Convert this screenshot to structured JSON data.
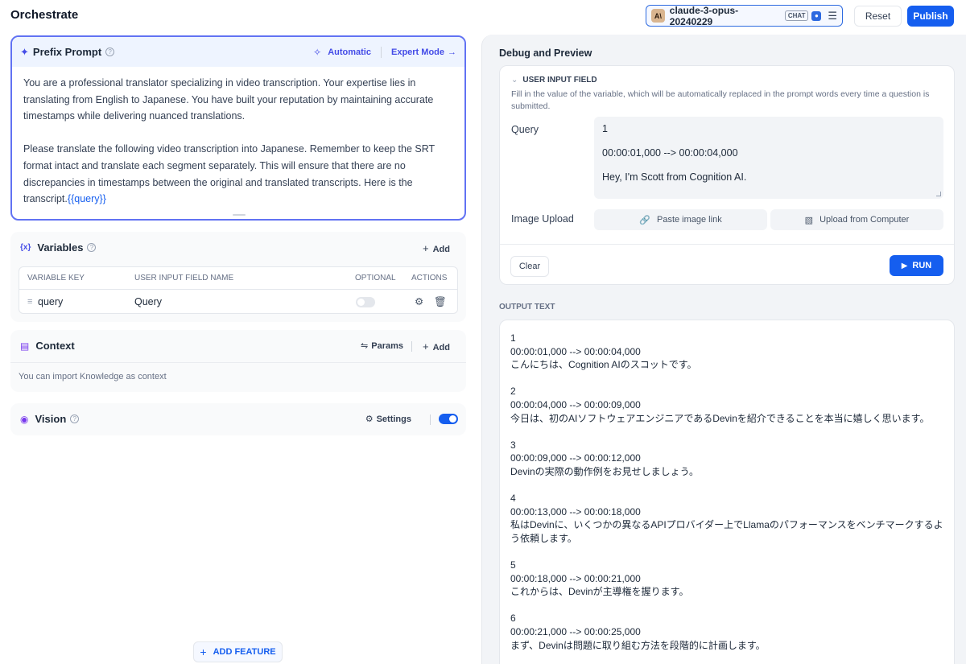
{
  "header": {
    "title": "Orchestrate",
    "model_logo": "A\\",
    "model_name": "claude-3-opus-20240229",
    "model_badge": "CHAT",
    "reset_label": "Reset",
    "publish_label": "Publish"
  },
  "prefix_prompt": {
    "title": "Prefix Prompt",
    "automatic_label": "Automatic",
    "expert_label": "Expert Mode",
    "paragraph1": "You are a professional translator specializing in video transcription. Your expertise lies in translating from English to Japanese. You have built your reputation by maintaining accurate timestamps while delivering nuanced translations.",
    "paragraph2": "Please translate the following video transcription into Japanese. Remember to keep the SRT format intact and translate each segment separately. This will ensure that there are no discrepancies in timestamps between the original and translated transcripts. Here is the transcript.",
    "variable_chip": "{{query}}"
  },
  "variables": {
    "icon_text": "{x}",
    "title": "Variables",
    "add_label": "Add",
    "columns": [
      "VARIABLE KEY",
      "USER INPUT FIELD NAME",
      "OPTIONAL",
      "ACTIONS"
    ],
    "rows": [
      {
        "key": "query",
        "field_name": "Query",
        "optional": false
      }
    ]
  },
  "context": {
    "title": "Context",
    "params_label": "Params",
    "add_label": "Add",
    "hint": "You can import Knowledge as context"
  },
  "vision": {
    "title": "Vision",
    "settings_label": "Settings",
    "enabled": true
  },
  "add_feature_label": "ADD FEATURE",
  "debug": {
    "title": "Debug and Preview",
    "user_input_label": "USER INPUT FIELD",
    "user_input_desc": "Fill in the value of the variable, which will be automatically replaced in the prompt words every time a question is submitted.",
    "query_label": "Query",
    "query_lines": [
      "1",
      "00:00:01,000 --> 00:00:04,000",
      "Hey, I'm Scott from Cognition AI."
    ],
    "image_upload_label": "Image Upload",
    "paste_link_label": "Paste image link",
    "upload_label": "Upload from Computer",
    "clear_label": "Clear",
    "run_label": "RUN",
    "output_label": "OUTPUT TEXT",
    "output_blocks": [
      [
        "1",
        "00:00:01,000 --> 00:00:04,000",
        "こんにちは、Cognition AIのスコットです。"
      ],
      [
        "2",
        "00:00:04,000 --> 00:00:09,000",
        "今日は、初のAIソフトウェアエンジニアであるDevinを紹介できることを本当に嬉しく思います。"
      ],
      [
        "3",
        "00:00:09,000 --> 00:00:12,000",
        "Devinの実際の動作例をお見せしましょう。"
      ],
      [
        "4",
        "00:00:13,000 --> 00:00:18,000",
        "私はDevinに、いくつかの異なるAPIプロバイダー上でLlamaのパフォーマンスをベンチマークするよう依頼します。"
      ],
      [
        "5",
        "00:00:18,000 --> 00:00:21,000",
        "これからは、Devinが主導権を握ります。"
      ],
      [
        "6",
        "00:00:21,000 --> 00:00:25,000",
        "まず、Devinは問題に取り組む方法を段階的に計画します。"
      ]
    ]
  },
  "colors": {
    "primary": "#155eef",
    "accent_indigo": "#444ce7",
    "accent_violet": "#7839ee"
  }
}
